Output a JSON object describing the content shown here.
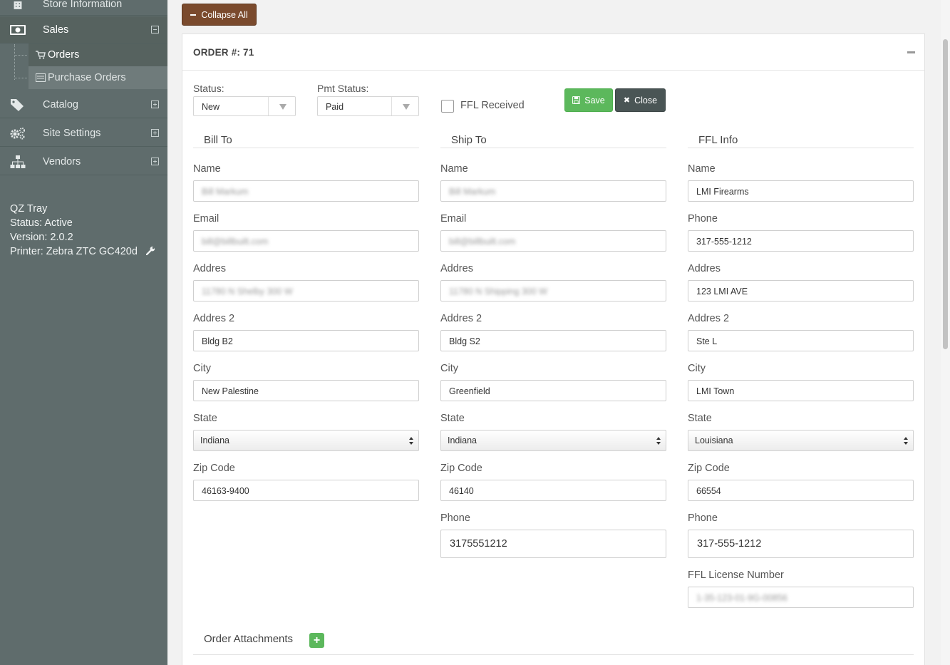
{
  "sidebar": {
    "top_item": "Store Information",
    "sales": {
      "label": "Sales"
    },
    "sales_sub": [
      {
        "label": "Orders"
      },
      {
        "label": "Purchase Orders"
      }
    ],
    "catalog": {
      "label": "Catalog"
    },
    "site_settings": {
      "label": "Site Settings"
    },
    "vendors": {
      "label": "Vendors"
    },
    "qz": {
      "title": "QZ Tray",
      "status": "Status: Active",
      "version": "Version: 2.0.2",
      "printer": "Printer: Zebra ZTC GC420d"
    }
  },
  "toolbar": {
    "collapse_label": "Collapse All"
  },
  "order": {
    "title": "ORDER #: 71",
    "status_label": "Status:",
    "status_value": "New",
    "pmt_label": "Pmt Status:",
    "pmt_value": "Paid",
    "ffl_received_label": "FFL Received",
    "save_label": "Save",
    "close_label": "Close"
  },
  "bill_to": {
    "title": "Bill To",
    "name_label": "Name",
    "name": "Bill Markum",
    "email_label": "Email",
    "email": "bill@billbuilt.com",
    "addr_label": "Addres",
    "addr": "11780 N Shelby 300 W",
    "addr2_label": "Addres 2",
    "addr2": "Bldg B2",
    "city_label": "City",
    "city": "New Palestine",
    "state_label": "State",
    "state": "Indiana",
    "zip_label": "Zip Code",
    "zip": "46163-9400"
  },
  "ship_to": {
    "title": "Ship To",
    "name_label": "Name",
    "name": "Bill Markum",
    "email_label": "Email",
    "email": "bill@billbuilt.com",
    "addr_label": "Addres",
    "addr": "11780 N Shipping 300 W",
    "addr2_label": "Addres 2",
    "addr2": "Bldg S2",
    "city_label": "City",
    "city": "Greenfield",
    "state_label": "State",
    "state": "Indiana",
    "zip_label": "Zip Code",
    "zip": "46140",
    "phone_label": "Phone",
    "phone": "3175551212"
  },
  "ffl_info": {
    "title": "FFL Info",
    "name_label": "Name",
    "name": "LMI Firearms",
    "phone_label": "Phone",
    "phone": "317-555-1212",
    "addr_label": "Addres",
    "addr": "123 LMI AVE",
    "addr2_label": "Addres 2",
    "addr2": "Ste L",
    "city_label": "City",
    "city": "LMI Town",
    "state_label": "State",
    "state": "Louisiana",
    "zip_label": "Zip Code",
    "zip": "66554",
    "phone2_label": "Phone",
    "phone2": "317-555-1212",
    "license_label": "FFL License Number",
    "license": "1-35-123-01-9G-00856"
  },
  "attachments": {
    "title": "Order Attachments",
    "add_label": "+"
  }
}
